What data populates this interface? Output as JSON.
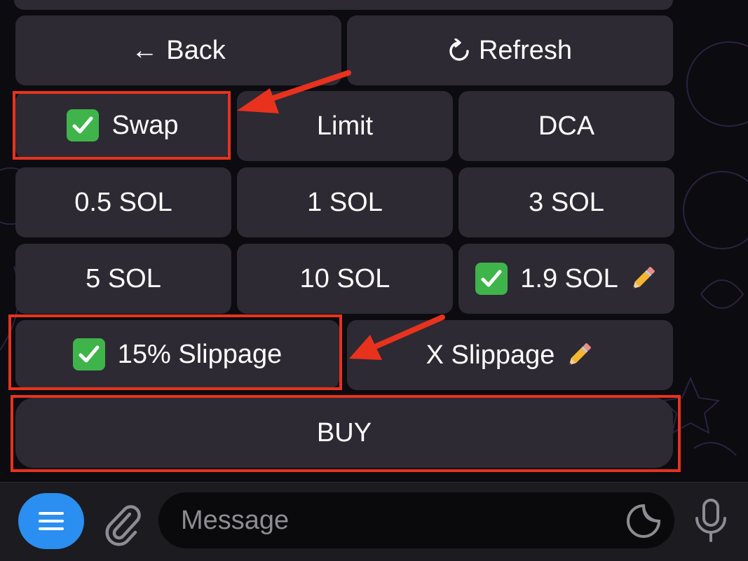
{
  "keyboard": {
    "back": {
      "arrow": "←",
      "label": "Back"
    },
    "refresh": {
      "icon": "refresh-icon",
      "label": "Refresh"
    },
    "swap": {
      "checked": true,
      "label": "Swap"
    },
    "limit": {
      "label": "Limit"
    },
    "dca": {
      "label": "DCA"
    },
    "sol_half": {
      "label": "0.5 SOL"
    },
    "sol_1": {
      "label": "1 SOL"
    },
    "sol_3": {
      "label": "3 SOL"
    },
    "sol_5": {
      "label": "5 SOL"
    },
    "sol_10": {
      "label": "10 SOL"
    },
    "sol_custom": {
      "checked": true,
      "label": "1.9 SOL",
      "icon": "pencil-icon"
    },
    "slippage_15": {
      "checked": true,
      "label": "15% Slippage"
    },
    "slippage_x": {
      "label": "X Slippage",
      "icon": "pencil-icon"
    },
    "buy": {
      "label": "BUY"
    }
  },
  "annotations": {
    "highlight_color": "#e8321e",
    "highlighted": [
      "swap",
      "slippage_15",
      "buy"
    ]
  },
  "composer": {
    "message_placeholder": "Message",
    "menu_color": "#2b8ef1",
    "icons": [
      "menu-icon",
      "paperclip-icon",
      "sticker-icon",
      "microphone-icon"
    ]
  }
}
